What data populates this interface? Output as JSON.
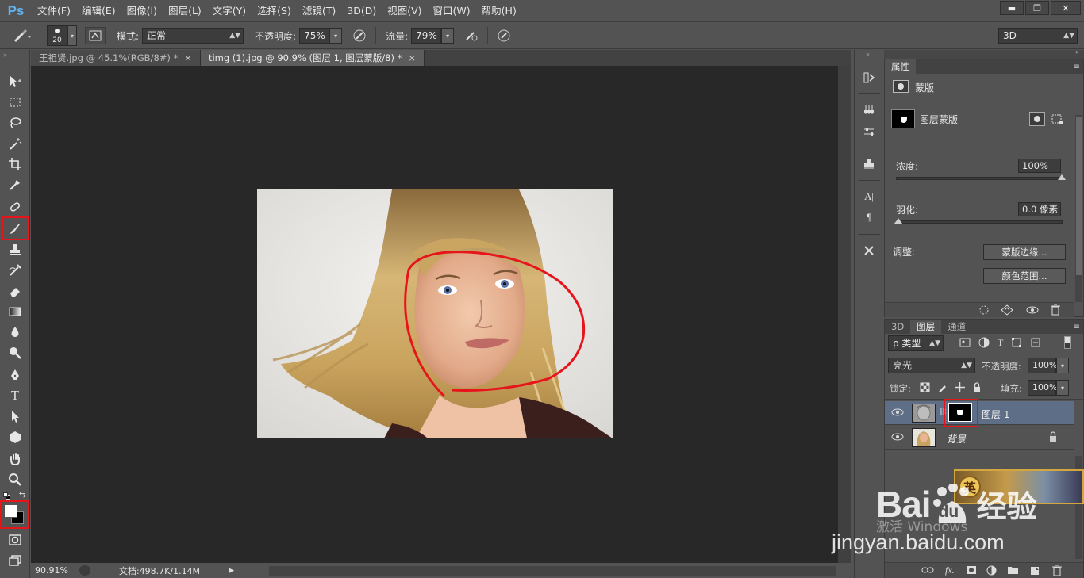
{
  "app": {
    "logo": "Ps"
  },
  "menu": [
    "文件(F)",
    "编辑(E)",
    "图像(I)",
    "图层(L)",
    "文字(Y)",
    "选择(S)",
    "滤镜(T)",
    "3D(D)",
    "视图(V)",
    "窗口(W)",
    "帮助(H)"
  ],
  "window_buttons": {
    "minimize": "▬",
    "restore": "❐",
    "close": "✕"
  },
  "options": {
    "brush_size": "20",
    "mode_label": "模式:",
    "mode_value": "正常",
    "opacity_label": "不透明度:",
    "opacity_value": "75%",
    "flow_label": "流量:",
    "flow_value": "79%",
    "workspace": "3D"
  },
  "tabs": [
    {
      "label": "王祖贤.jpg @ 45.1%(RGB/8#) *",
      "close": "×"
    },
    {
      "label": "timg (1).jpg @ 90.9% (图层 1, 图层蒙版/8) *",
      "close": "×"
    }
  ],
  "status": {
    "zoom": "90.91%",
    "doc": "文档:498.7K/1.14M"
  },
  "properties": {
    "tab": "属性",
    "section": "蒙版",
    "mask_name": "图层蒙版",
    "density_label": "浓度:",
    "density_value": "100%",
    "density_level": 100,
    "feather_label": "羽化:",
    "feather_value": "0.0 像素",
    "feather_level": 0,
    "adjust_label": "调整:",
    "mask_edge_button": "蒙版边缘...",
    "color_range_button": "颜色范围..."
  },
  "layers_panel": {
    "tabs": [
      "3D",
      "图层",
      "通道"
    ],
    "active_tab": "图层",
    "filter_kind": "ρ 类型",
    "blend_mode": "亮光",
    "opacity_label": "不透明度:",
    "opacity_value": "100%",
    "lock_label": "锁定:",
    "fill_label": "填充:",
    "fill_value": "100%",
    "layers": [
      {
        "name": "图层 1",
        "selected": true
      },
      {
        "name": "背景",
        "selected": false
      }
    ]
  },
  "watermark": {
    "brand_main": "Bai",
    "brand_paw": "du",
    "brand_cn": "经验",
    "windows": "激活 Windows",
    "url": "jingyan.baidu.com",
    "banner_char": "英"
  },
  "colors": {
    "accent_red": "#e8141b",
    "panel_bg": "#535353",
    "canvas_bg": "#282828",
    "selected_layer": "#5d6e86"
  }
}
